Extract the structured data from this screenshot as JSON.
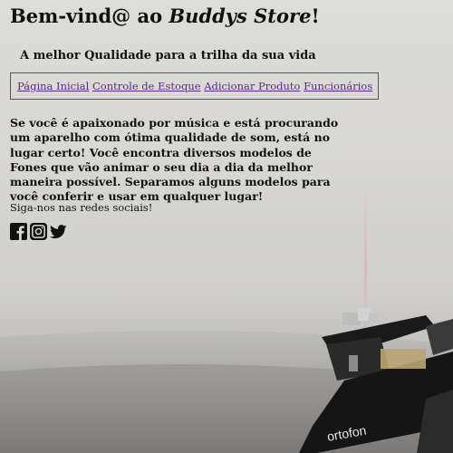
{
  "header": {
    "title_prefix": "Bem-vind@ ao ",
    "title_brand": "Buddys Store",
    "title_suffix": "!",
    "tagline": "A melhor Qualidade para a trilha da sua vida"
  },
  "nav": {
    "items": [
      {
        "label": "Página Inicial"
      },
      {
        "label": "Controle de Estoque"
      },
      {
        "label": "Adicionar Produto"
      },
      {
        "label": "Funcionários"
      }
    ]
  },
  "main": {
    "intro": "Se você é apaixonado por música e está procurando um aparelho com ótima qualidade de som, está no lugar certo! Você encontra diversos modelos de Fones que vão animar o seu dia a dia da melhor maneira possível. Separamos alguns modelos para você conferir e usar em qualquer lugar!",
    "social_title": "Siga-nos nas redes sociais!",
    "social_icons": [
      "facebook-icon",
      "instagram-icon",
      "twitter-icon"
    ]
  },
  "background": {
    "cartridge_brand": "ortofon"
  },
  "colors": {
    "link": "#5b2a8a",
    "text": "#111111"
  }
}
